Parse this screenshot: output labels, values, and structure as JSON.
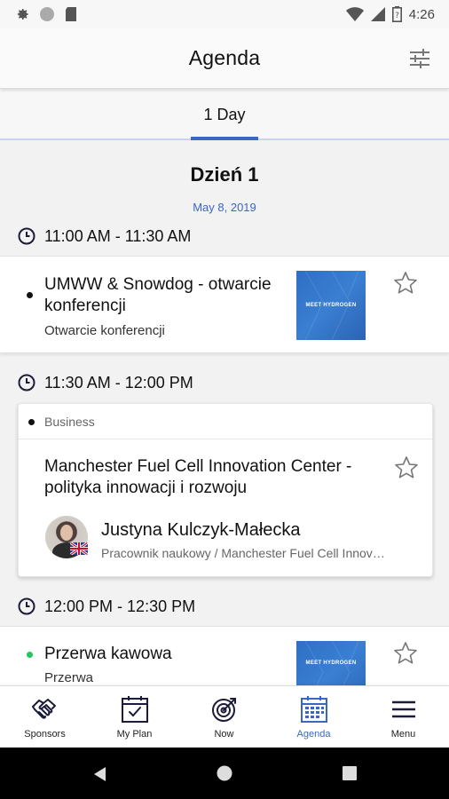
{
  "status_bar": {
    "time": "4:26",
    "icons": [
      "settings-icon",
      "circle-icon",
      "sd-card-icon",
      "wifi-icon",
      "signal-icon",
      "battery-icon"
    ]
  },
  "app_bar": {
    "title": "Agenda",
    "filter_icon": "filter-sliders-icon"
  },
  "tabs": [
    {
      "label": "1 Day",
      "active": true
    }
  ],
  "day": {
    "title": "Dzień 1",
    "date": "May 8, 2019"
  },
  "sessions": [
    {
      "time": "11:00 AM - 11:30 AM",
      "title": "UMWW & Snowdog - otwarcie konferencji",
      "subtitle": "Otwarcie konferencji",
      "dot_color": "#111111",
      "thumb_text": "MEET HYDROGEN",
      "favorite": false
    },
    {
      "time": "11:30 AM - 12:00 PM",
      "category": "Business",
      "title": "Manchester Fuel Cell Innovation Center - polityka innowacji i rozwoju",
      "speaker": {
        "name": "Justyna Kulczyk-Małecka",
        "role": "Pracownik naukowy / Manchester Fuel Cell Innovation Center"
      },
      "dot_color": "#111111",
      "favorite": false
    },
    {
      "time": "12:00 PM - 12:30 PM",
      "title": "Przerwa kawowa",
      "subtitle": "Przerwa",
      "dot_color": "#22c55e",
      "thumb_text": "MEET HYDROGEN",
      "favorite": false
    }
  ],
  "bottom_nav": [
    {
      "label": "Sponsors",
      "icon": "handshake-icon",
      "active": false
    },
    {
      "label": "My Plan",
      "icon": "calendar-check-icon",
      "active": false
    },
    {
      "label": "Now",
      "icon": "target-icon",
      "active": false
    },
    {
      "label": "Agenda",
      "icon": "calendar-grid-icon",
      "active": true
    },
    {
      "label": "Menu",
      "icon": "hamburger-icon",
      "active": false
    }
  ],
  "colors": {
    "accent": "#3a66c4",
    "thumb_blue": "#2e6fc4",
    "break_dot": "#22c55e"
  }
}
